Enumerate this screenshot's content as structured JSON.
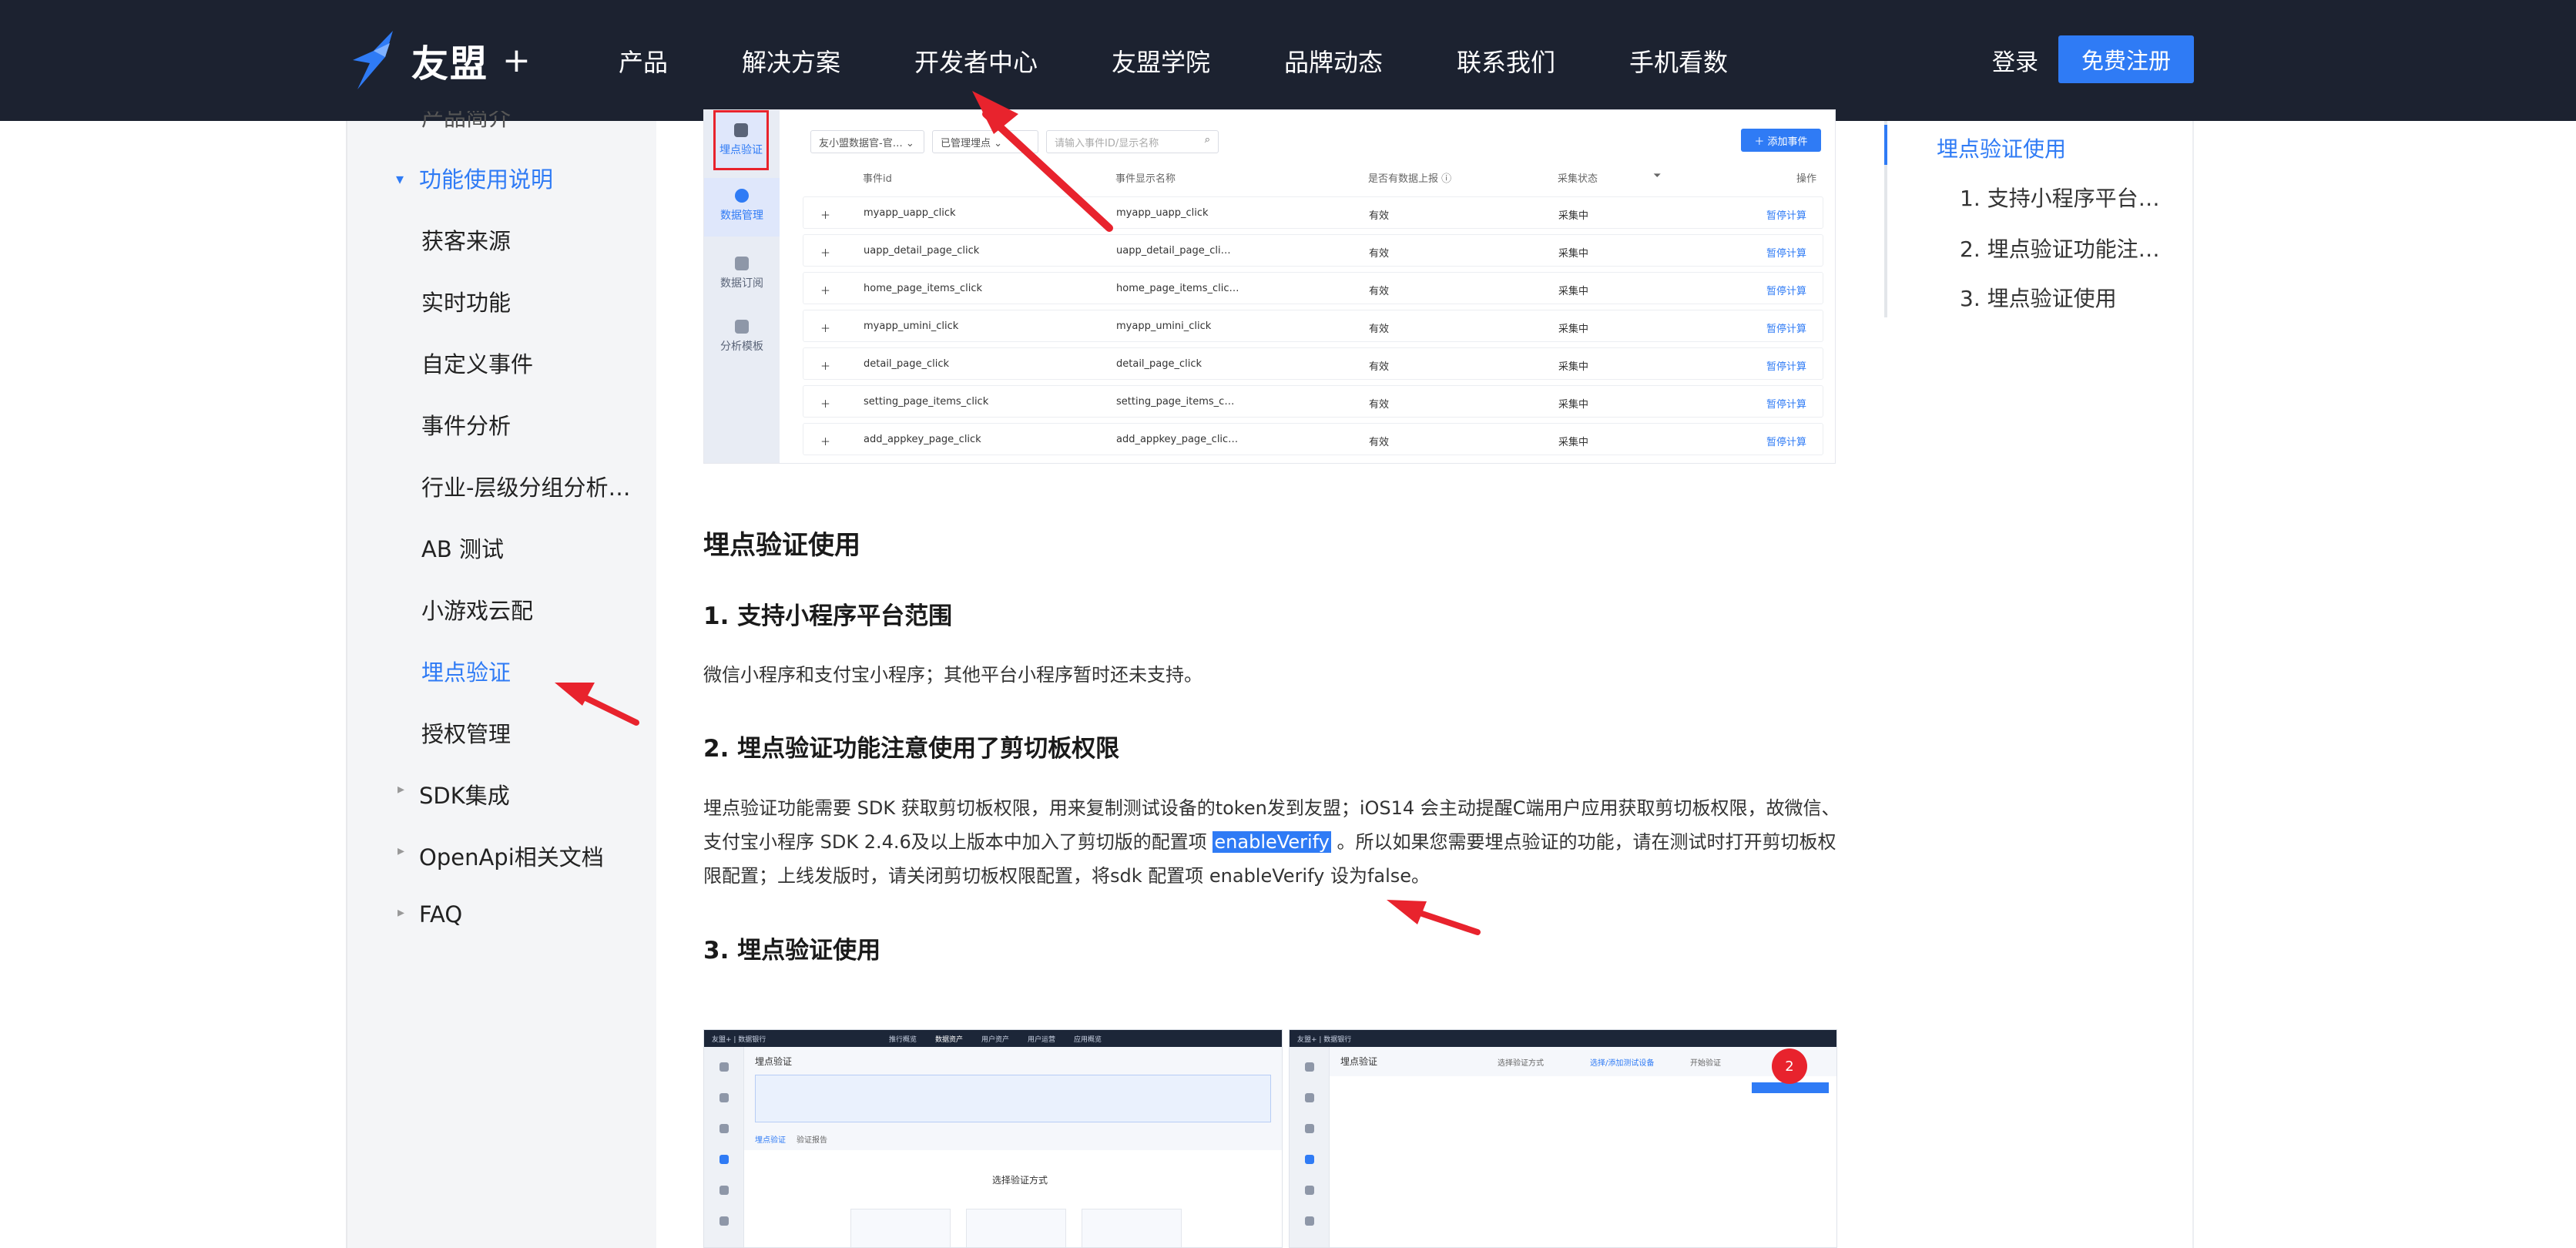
{
  "nav": {
    "logo_text": "友盟",
    "logo_plus": "+",
    "items": [
      "产品",
      "解决方案",
      "开发者中心",
      "友盟学院",
      "品牌动态",
      "联系我们",
      "手机看数"
    ],
    "login": "登录",
    "register": "免费注册"
  },
  "sidebar": {
    "cut_item": "产品简介",
    "open_category": "功能使用说明",
    "items": [
      "获客来源",
      "实时功能",
      "自定义事件",
      "事件分析",
      "行业-层级分组分析…",
      "AB 测试",
      "小游戏云配",
      "埋点验证",
      "授权管理"
    ],
    "active_item": "埋点验证",
    "categories": [
      "SDK集成",
      "OpenApi相关文档",
      "FAQ"
    ]
  },
  "toc": {
    "items": [
      "埋点验证使用",
      "1. 支持小程序平台…",
      "2. 埋点验证功能注…",
      "3. 埋点验证使用"
    ],
    "active": "埋点验证使用"
  },
  "content": {
    "section_title": "埋点验证使用",
    "h1": "1. 支持小程序平台范围",
    "p1": "微信小程序和支付宝小程序；其他平台小程序暂时还未支持。",
    "h2": "2. 埋点验证功能注意使用了剪切板权限",
    "p2_line1": "埋点验证功能需要 SDK 获取剪切板权限，用来复制测试设备的token发到友盟；iOS14 会主动提醒C端用户应用获取剪切板权限，故微信、",
    "p2_line2_pre": "支付宝小程序 SDK 2.4.6及以上版本中加入了剪切版的配置项 ",
    "p2_highlight": "enableVerify",
    "p2_line2_post": " 。所以如果您需要埋点验证的功能，请在测试时打开剪切板权",
    "p2_line3": "限配置；上线发版时，请关闭剪切板权限配置，将sdk 配置项 enableVerify 设为false。",
    "h3": "3. 埋点验证使用"
  },
  "shot1": {
    "sidebar": [
      "埋点验证",
      "数据管理",
      "数据订阅",
      "分析模板"
    ],
    "filter1": "友小盟数据官-官… ⌄",
    "filter2": "已管理埋点 ⌄",
    "search_placeholder": "请输入事件ID/显示名称",
    "add_button": "＋ 添加事件",
    "headers": [
      "事件id",
      "事件显示名称",
      "是否有数据上报 ⓘ",
      "采集状态",
      "操作"
    ],
    "rows": [
      {
        "id": "myapp_uapp_click",
        "name": "myapp_uapp_click",
        "valid": "有效",
        "status": "采集中",
        "op": "暂停计算"
      },
      {
        "id": "uapp_detail_page_click",
        "name": "uapp_detail_page_cli…",
        "valid": "有效",
        "status": "采集中",
        "op": "暂停计算"
      },
      {
        "id": "home_page_items_click",
        "name": "home_page_items_clic…",
        "valid": "有效",
        "status": "采集中",
        "op": "暂停计算"
      },
      {
        "id": "myapp_umini_click",
        "name": "myapp_umini_click",
        "valid": "有效",
        "status": "采集中",
        "op": "暂停计算"
      },
      {
        "id": "detail_page_click",
        "name": "detail_page_click",
        "valid": "有效",
        "status": "采集中",
        "op": "暂停计算"
      },
      {
        "id": "setting_page_items_click",
        "name": "setting_page_items_c…",
        "valid": "有效",
        "status": "采集中",
        "op": "暂停计算"
      },
      {
        "id": "add_appkey_page_click",
        "name": "add_appkey_page_clic…",
        "valid": "有效",
        "status": "采集中",
        "op": "暂停计算"
      }
    ]
  },
  "shot2": {
    "left_brand": "友盟+ | 数据银行",
    "left_tabs": [
      "推行概览",
      "数据资产",
      "用户资产",
      "用户运营",
      "应用概览"
    ],
    "left_title": "埋点验证",
    "left_subtabs": [
      "埋点验证",
      "验证报告"
    ],
    "left_center": "选择验证方式",
    "right_brand": "友盟+ | 数据银行",
    "right_title": "埋点验证",
    "right_steps": [
      "选择验证方式",
      "选择/添加测试设备",
      "开始验证"
    ],
    "badge": "2"
  },
  "colors": {
    "nav_bg": "#1c2230",
    "accent": "#2f7bf5",
    "annotation_red": "#e8232d"
  }
}
